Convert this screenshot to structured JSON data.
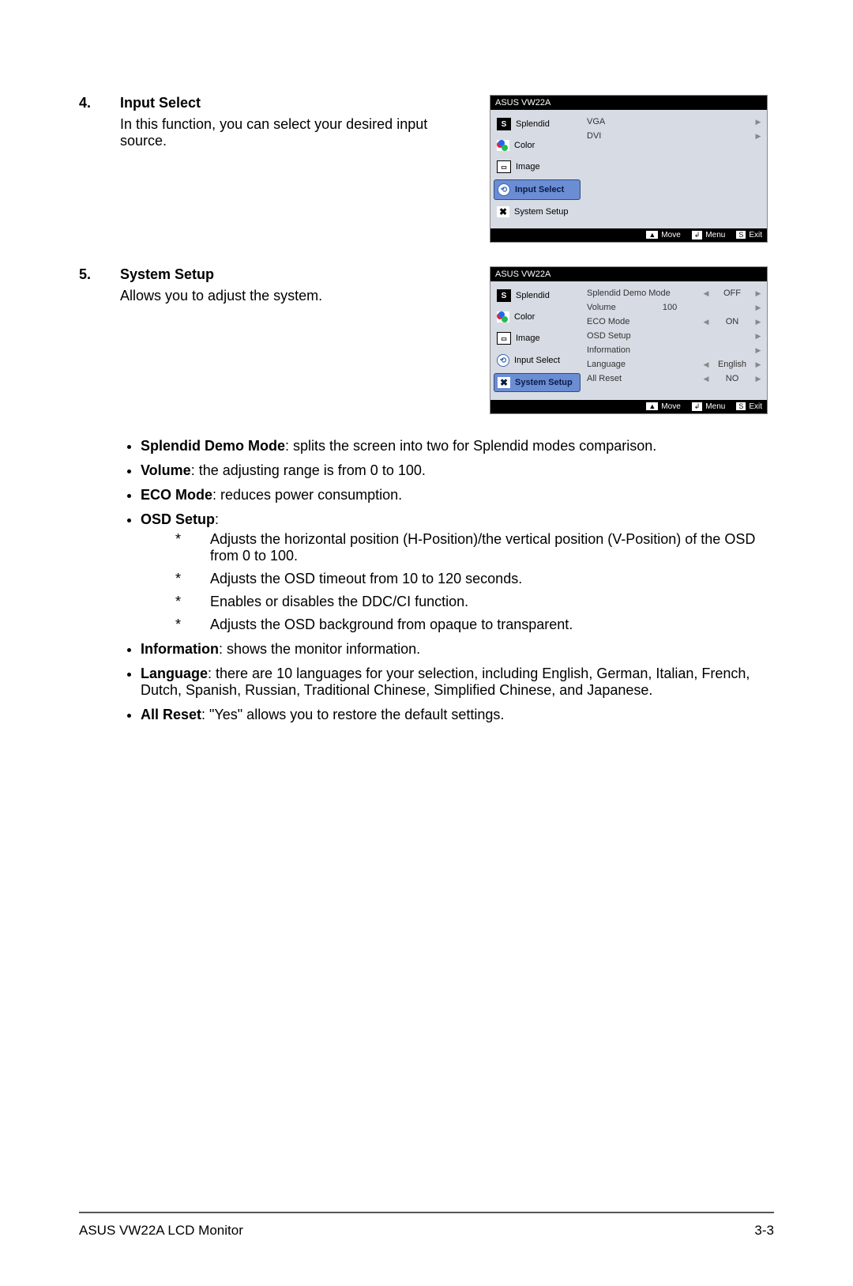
{
  "sections": {
    "s4": {
      "num": "4.",
      "title": "Input Select",
      "desc": "In this function, you can select your desired input source."
    },
    "s5": {
      "num": "5.",
      "title": "System Setup",
      "desc": "Allows you to adjust the system."
    }
  },
  "osd": {
    "title": "ASUS VW22A",
    "menu": {
      "splendid": "Splendid",
      "color": "Color",
      "image": "Image",
      "input": "Input Select",
      "system": "System Setup"
    },
    "footer": {
      "move": "Move",
      "menu": "Menu",
      "exit": "Exit"
    },
    "input": {
      "vga": "VGA",
      "dvi": "DVI"
    },
    "system": {
      "demo": {
        "label": "Splendid Demo Mode",
        "val": "OFF"
      },
      "volume": {
        "label": "Volume",
        "val": "100"
      },
      "eco": {
        "label": "ECO Mode",
        "val": "ON"
      },
      "osd": {
        "label": "OSD Setup"
      },
      "info": {
        "label": "Information"
      },
      "lang": {
        "label": "Language",
        "val": "English"
      },
      "reset": {
        "label": "All Reset",
        "val": "NO"
      }
    }
  },
  "bullets": {
    "demo": {
      "title": "Splendid Demo Mode",
      "text": ": splits the screen into two for Splendid modes comparison."
    },
    "volume": {
      "title": "Volume",
      "text": ": the adjusting range is from 0 to 100."
    },
    "eco": {
      "title": "ECO Mode",
      "text": ": reduces power consumption."
    },
    "osd": {
      "title": "OSD Setup",
      "colon": ":",
      "sub1": "Adjusts the horizontal position (H-Position)/the vertical position (V-Position) of the OSD from 0 to 100.",
      "sub2": "Adjusts the OSD timeout from 10 to 120 seconds.",
      "sub3": "Enables or disables the DDC/CI function.",
      "sub4": "Adjusts the OSD background from opaque to transparent."
    },
    "info": {
      "title": "Information",
      "text": ": shows the monitor information."
    },
    "lang": {
      "title": "Language",
      "text": ": there are 10 languages for your selection, including English, German, Italian, French, Dutch, Spanish, Russian, Traditional Chinese, Simplified Chinese, and Japanese."
    },
    "reset": {
      "title": "All Reset",
      "text": ": \"Yes\" allows you to restore the default settings."
    }
  },
  "footer": {
    "left": "ASUS VW22A LCD Monitor",
    "right": "3-3"
  },
  "glyph": {
    "ast": "*",
    "s": "S",
    "img": "▭",
    "arrow": "⟲",
    "wrench": "✖",
    "menu": "↲",
    "updown": "▲▼"
  }
}
